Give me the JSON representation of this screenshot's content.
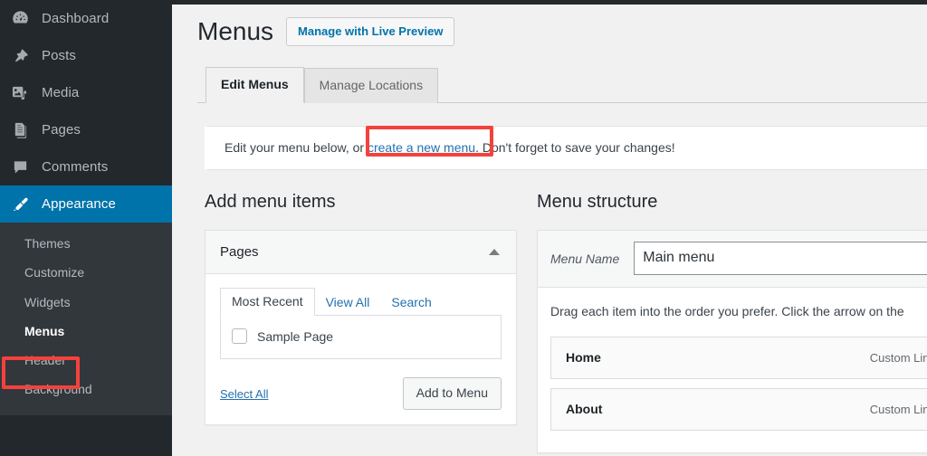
{
  "sidebar": {
    "items": [
      {
        "label": "Dashboard",
        "icon": "dashboard-gauge-icon",
        "current": false
      },
      {
        "label": "Posts",
        "icon": "pin-icon",
        "current": false
      },
      {
        "label": "Media",
        "icon": "media-icon",
        "current": false
      },
      {
        "label": "Pages",
        "icon": "pages-icon",
        "current": false
      },
      {
        "label": "Comments",
        "icon": "comment-bubble-icon",
        "current": false
      },
      {
        "label": "Appearance",
        "icon": "paintbrush-icon",
        "current": true
      }
    ],
    "submenu": [
      {
        "label": "Themes",
        "active": false
      },
      {
        "label": "Customize",
        "active": false
      },
      {
        "label": "Widgets",
        "active": false
      },
      {
        "label": "Menus",
        "active": true
      },
      {
        "label": "Header",
        "active": false
      },
      {
        "label": "Background",
        "active": false
      }
    ],
    "accent_color": "#0073aa",
    "background_color": "#23282d",
    "submenu_background_color": "#32373c"
  },
  "header": {
    "title": "Menus",
    "live_preview_label": "Manage with Live Preview",
    "tabs": [
      {
        "label": "Edit Menus",
        "active": true
      },
      {
        "label": "Manage Locations",
        "active": false
      }
    ]
  },
  "notice": {
    "text_before": "Edit your menu below, or ",
    "link_label": "create a new menu",
    "text_after": ". Don't forget to save your changes!"
  },
  "add_menu_items": {
    "section_title": "Add menu items",
    "panel_title": "Pages",
    "toggle_icon": "triangle-up-icon",
    "tabs": [
      {
        "label": "Most Recent",
        "active": true
      },
      {
        "label": "View All",
        "active": false
      },
      {
        "label": "Search",
        "active": false
      }
    ],
    "pages": [
      {
        "label": "Sample Page",
        "checked": false
      }
    ],
    "select_all_label": "Select All",
    "add_to_menu_label": "Add to Menu"
  },
  "menu_structure": {
    "section_title": "Menu structure",
    "menu_name_label": "Menu Name",
    "menu_name_value": "Main menu",
    "menu_name_placeholder": "Menu Name",
    "instructions": "Drag each item into the order you prefer. Click the arrow on the",
    "items": [
      {
        "title": "Home",
        "type": "Custom Link"
      },
      {
        "title": "About",
        "type": "Custom Link"
      }
    ]
  },
  "annotations": {
    "highlight_color": "#f5413c",
    "boxes": [
      {
        "target": "sidebar-item-menus"
      },
      {
        "target": "create-a-new-menu-link"
      }
    ]
  }
}
